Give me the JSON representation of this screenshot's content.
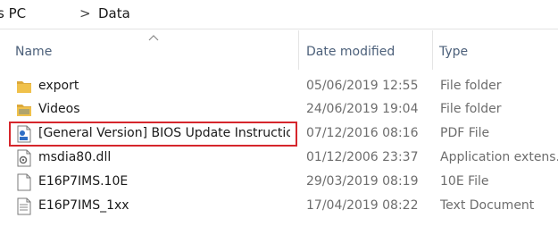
{
  "breadcrumb": {
    "items": [
      "s PC",
      "Data"
    ],
    "separator": ">"
  },
  "columns": {
    "name": "Name",
    "date_modified": "Date modified",
    "type": "Type"
  },
  "files": [
    {
      "name": "export",
      "date": "05/06/2019 12:55",
      "type": "File folder",
      "icon": "folder-icon"
    },
    {
      "name": "Videos",
      "date": "24/06/2019 19:04",
      "type": "File folder",
      "icon": "folder-icon"
    },
    {
      "name": "[General Version] BIOS Update Instructio...",
      "date": "07/12/2016 08:16",
      "type": "PDF File",
      "icon": "pdf-file-icon"
    },
    {
      "name": "msdia80.dll",
      "date": "01/12/2006 23:37",
      "type": "Application extens...",
      "icon": "dll-file-icon"
    },
    {
      "name": "E16P7IMS.10E",
      "date": "29/03/2019 08:19",
      "type": "10E File",
      "icon": "generic-file-icon"
    },
    {
      "name": "E16P7IMS_1xx",
      "date": "17/04/2019 08:22",
      "type": "Text Document",
      "icon": "text-file-icon"
    }
  ],
  "colors": {
    "highlight": "#d6262c",
    "folder": "#f0c14b",
    "header_text": "#4c607a"
  }
}
